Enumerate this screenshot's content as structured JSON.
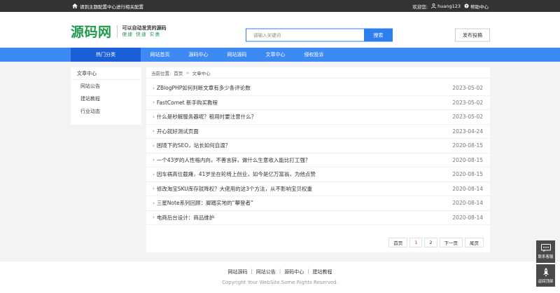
{
  "topbar": {
    "notice": "请到主题配置中心进行相关配置",
    "welcome": "欢迎您:",
    "username": "huang123",
    "help": "帮助中心"
  },
  "header": {
    "logo_title": "源码网",
    "tagline_1": "可以自动发货的源码",
    "tagline_2": "便捷 快速 实惠",
    "search_placeholder": "请输入关键词",
    "search_button": "搜索",
    "post_button": "发布投稿"
  },
  "nav": {
    "category": "热门分类",
    "links": [
      "网站首页",
      "源码中心",
      "网站源码",
      "文章中心",
      "侵权投诉"
    ]
  },
  "sidebar": {
    "title": "文章中心",
    "items": [
      "网站公告",
      "建站教程",
      "行业动态"
    ]
  },
  "breadcrumb": {
    "label": "当前位置:",
    "home": "首页",
    "sep": ">",
    "current": "文章中心"
  },
  "articles": [
    {
      "title": "ZBlogPHP如何判断文章有多少条评论数",
      "date": "2023-05-02"
    },
    {
      "title": "FastComet 新手购买教程",
      "date": "2023-05-02"
    },
    {
      "title": "什么是秒解服务器呢？租用时要注意什么？",
      "date": "2023-05-02"
    },
    {
      "title": "开心就好测试页面",
      "date": "2023-04-24"
    },
    {
      "title": "困境下的SEO，站长如何自渡？",
      "date": "2020-08-15"
    },
    {
      "title": "一个43岁的人性格内向，不善言辞，做什么生意收入能比打工强？",
      "date": "2020-08-15"
    },
    {
      "title": "因车祸高位截瘫，41岁坐在轮椅上创业，如今是亿万富翁，为他点赞",
      "date": "2020-08-15"
    },
    {
      "title": "修改淘宝SKU库存就降权？大佬用的这3个方法，从不影响宝贝权重",
      "date": "2020-08-14"
    },
    {
      "title": "三星Note系列回顾：脚踏实地的“攀登者”",
      "date": "2020-08-14"
    },
    {
      "title": "电商后台设计：商品维护",
      "date": "2020-08-14"
    }
  ],
  "pager": {
    "first": "首页",
    "pages": [
      "1",
      "2"
    ],
    "next": "下一页",
    "last": "尾页"
  },
  "footer": {
    "links": [
      "网站源码",
      "网站公告",
      "源码中心",
      "建站教程"
    ],
    "pipe": "|",
    "copyright": "Copyright Your WebSite.Some Rights Reserved."
  },
  "float": {
    "contact": "联系客服",
    "top": "返回顶部"
  }
}
